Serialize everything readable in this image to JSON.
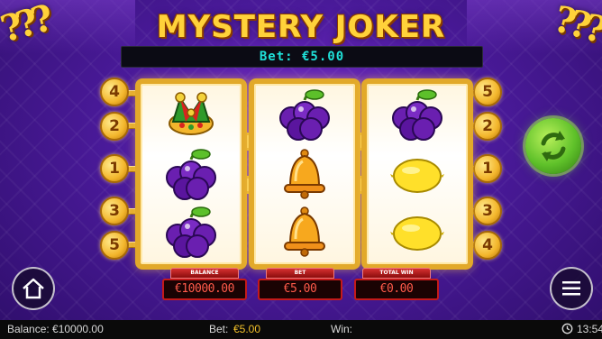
{
  "game": {
    "title": "MYSTERY JOKER",
    "bet_banner": "Bet: €5.00"
  },
  "paylines": {
    "left": [
      "4",
      "2",
      "1",
      "3",
      "5"
    ],
    "right": [
      "5",
      "2",
      "1",
      "3",
      "4"
    ]
  },
  "reels": [
    [
      "joker",
      "plums",
      "plums"
    ],
    [
      "plums",
      "bell",
      "bell"
    ],
    [
      "plums",
      "lemon",
      "lemon"
    ]
  ],
  "meters": {
    "balance": {
      "label": "BALANCE",
      "value": "€10000.00"
    },
    "bet": {
      "label": "BET",
      "value": "€5.00"
    },
    "total_win": {
      "label": "TOTAL WIN",
      "value": "€0.00"
    }
  },
  "status_bar": {
    "balance": "Balance: €10000.00",
    "bet_label": "Bet:",
    "bet_value": "€5.00",
    "win_label": "Win:",
    "time": "13:54"
  },
  "corner_marks": "???",
  "icons": {
    "spin": "spin-arrows-icon",
    "home": "home-icon",
    "menu": "hamburger-menu-icon",
    "clock": "clock-icon"
  },
  "colors": {
    "gold": "#e2a92a",
    "banner_text": "#1fe0d8",
    "meter_red": "#c41a1a",
    "spin_green": "#5fc12a",
    "bet_yellow": "#f2c12a"
  }
}
